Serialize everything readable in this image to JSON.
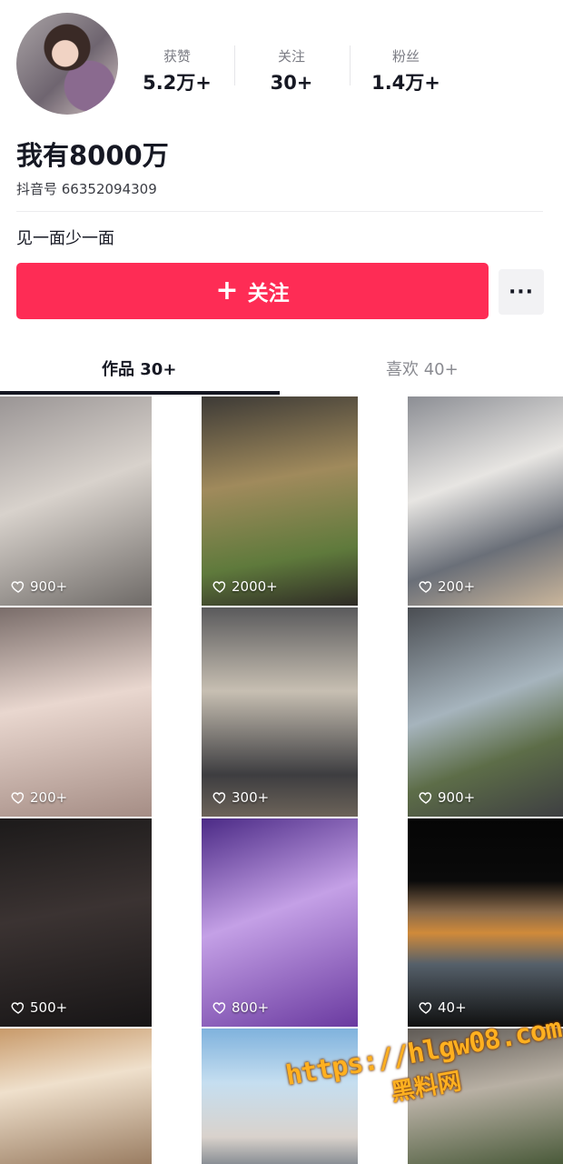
{
  "profile": {
    "name": "我有8000万",
    "douyin_id": "抖音号 66352094309",
    "bio": "见一面少一面"
  },
  "stats": [
    {
      "label": "获赞",
      "value": "5.2万+"
    },
    {
      "label": "关注",
      "value": "30+"
    },
    {
      "label": "粉丝",
      "value": "1.4万+"
    }
  ],
  "actions": {
    "follow_label": "关注",
    "more_label": "···"
  },
  "tabs": [
    {
      "label": "作品 30+",
      "active": true
    },
    {
      "label": "喜欢 40+",
      "active": false
    }
  ],
  "videos": [
    {
      "likes": "900+"
    },
    {
      "likes": "2000+"
    },
    {
      "likes": "200+"
    },
    {
      "likes": "200+"
    },
    {
      "likes": "300+"
    },
    {
      "likes": "900+"
    },
    {
      "likes": "500+"
    },
    {
      "likes": "800+"
    },
    {
      "likes": "40+"
    },
    {
      "likes": ""
    },
    {
      "likes": ""
    },
    {
      "likes": ""
    }
  ],
  "watermark": {
    "url": "https://hlgw08.com",
    "name": "黑料网"
  },
  "colors": {
    "accent": "#fe2c55",
    "text": "#161823",
    "muted": "#8a8b91"
  }
}
